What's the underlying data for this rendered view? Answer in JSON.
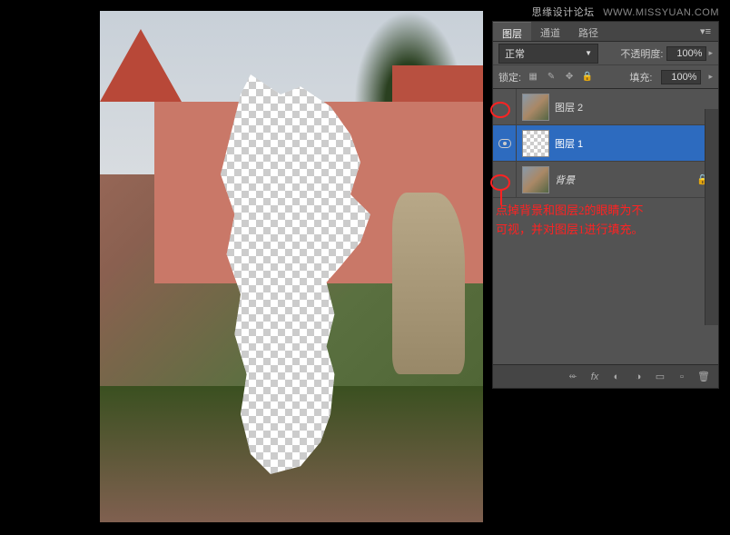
{
  "watermark": {
    "cn": "思缘设计论坛",
    "url": "WWW.MISSYUAN.COM"
  },
  "tabs": {
    "layers": "图层",
    "channels": "通道",
    "paths": "路径"
  },
  "blend": {
    "mode": "正常",
    "opacity_label": "不透明度:",
    "opacity_value": "100%"
  },
  "lock": {
    "label": "锁定:",
    "fill_label": "填充:",
    "fill_value": "100%"
  },
  "layers": [
    {
      "name": "图层 2",
      "visible": false,
      "selected": false,
      "locked": false
    },
    {
      "name": "图层 1",
      "visible": true,
      "selected": true,
      "locked": false
    },
    {
      "name": "背景",
      "visible": false,
      "selected": false,
      "locked": true
    }
  ],
  "annotation": {
    "line1": "点掉背景和图层2的眼睛为不",
    "line2": "可视，并对图层1进行填充。"
  },
  "icons": {
    "link": "⬰",
    "fx": "fx",
    "mask": "◐",
    "adjust": "◑",
    "folder": "▭",
    "new": "▫",
    "trash": "🗑"
  }
}
